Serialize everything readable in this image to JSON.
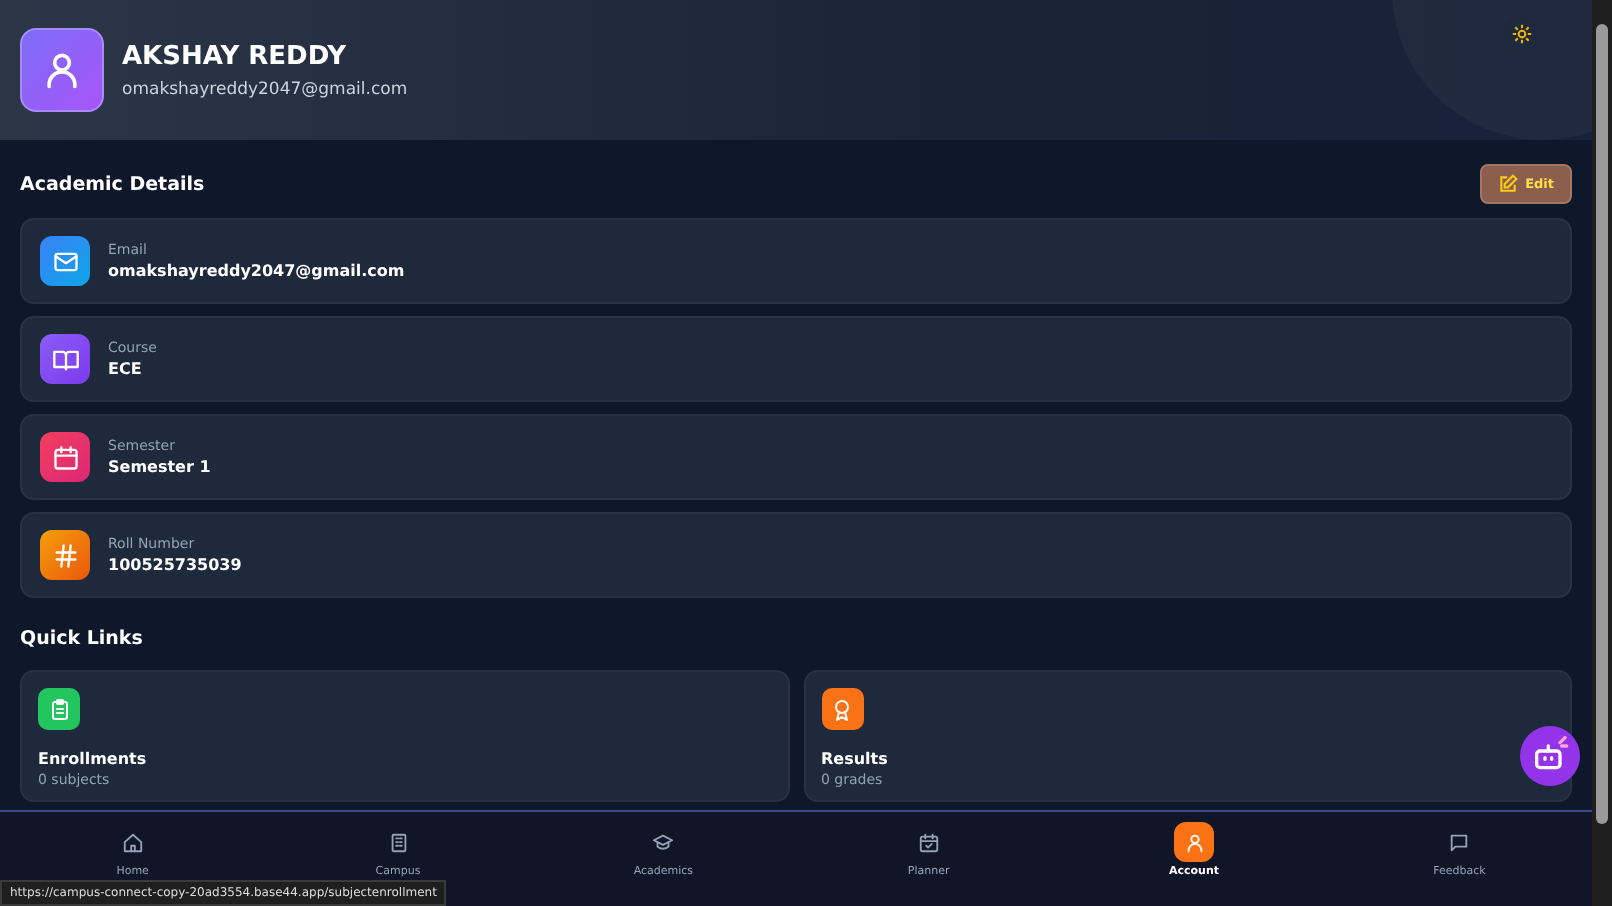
{
  "profile": {
    "name": "AKSHAY REDDY",
    "email": "omakshayreddy2047@gmail.com"
  },
  "academic_details": {
    "title": "Academic Details",
    "edit_button": "Edit",
    "items": [
      {
        "kind": "email",
        "label": "Email",
        "value": "omakshayreddy2047@gmail.com"
      },
      {
        "kind": "course",
        "label": "Course",
        "value": "ECE"
      },
      {
        "kind": "semester",
        "label": "Semester",
        "value": "Semester 1"
      },
      {
        "kind": "roll",
        "label": "Roll Number",
        "value": "100525735039"
      }
    ]
  },
  "quick_links": {
    "title": "Quick Links",
    "items": [
      {
        "kind": "enrollments",
        "title": "Enrollments",
        "subtitle": "0 subjects"
      },
      {
        "kind": "results",
        "title": "Results",
        "subtitle": "0 grades"
      }
    ]
  },
  "nav": [
    {
      "kind": "home",
      "label": "Home",
      "selected": false
    },
    {
      "kind": "campus",
      "label": "Campus",
      "selected": false
    },
    {
      "kind": "academics",
      "label": "Academics",
      "selected": false
    },
    {
      "kind": "planner",
      "label": "Planner",
      "selected": false
    },
    {
      "kind": "account",
      "label": "Account",
      "selected": true
    },
    {
      "kind": "feedback",
      "label": "Feedback",
      "selected": false
    }
  ],
  "status_url": "https://campus-connect-copy-20ad3554.base44.app/subjectenrollment"
}
